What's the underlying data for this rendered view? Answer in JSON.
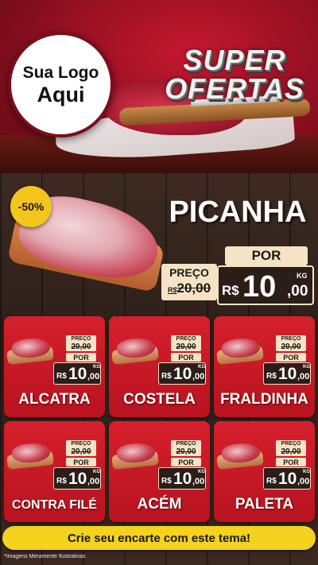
{
  "header": {
    "logo_line1": "Sua Logo",
    "logo_line2": "Aqui",
    "title_line1": "SUPER",
    "title_line2": "OFERTAS"
  },
  "featured": {
    "discount": "-50%",
    "name": "PICANHA",
    "por_label": "POR",
    "preco_label": "PREÇO",
    "old_currency": "R$",
    "old_price": "20,00",
    "new_currency": "R$",
    "new_int": "10",
    "new_dec": ",00",
    "unit": "KG"
  },
  "cards": [
    {
      "name": "ALCATRA",
      "preco_label": "PREÇO",
      "old_price": "20,00",
      "por_label": "POR",
      "currency": "R$",
      "new_int": "10",
      "new_dec": ",00",
      "unit": "KG"
    },
    {
      "name": "COSTELA",
      "preco_label": "PREÇO",
      "old_price": "20,00",
      "por_label": "POR",
      "currency": "R$",
      "new_int": "10",
      "new_dec": ",00",
      "unit": "KG"
    },
    {
      "name": "FRALDINHA",
      "preco_label": "PREÇO",
      "old_price": "20,00",
      "por_label": "POR",
      "currency": "R$",
      "new_int": "10",
      "new_dec": ",00",
      "unit": "KG"
    },
    {
      "name": "CONTRA FILÉ",
      "preco_label": "PREÇO",
      "old_price": "20,00",
      "por_label": "POR",
      "currency": "R$",
      "new_int": "10",
      "new_dec": ",00",
      "unit": "KG"
    },
    {
      "name": "ACÉM",
      "preco_label": "PREÇO",
      "old_price": "20,00",
      "por_label": "POR",
      "currency": "R$",
      "new_int": "10",
      "new_dec": ",00",
      "unit": "KG"
    },
    {
      "name": "PALETA",
      "preco_label": "PREÇO",
      "old_price": "20,00",
      "por_label": "POR",
      "currency": "R$",
      "new_int": "10",
      "new_dec": ",00",
      "unit": "KG"
    }
  ],
  "cta": {
    "label": "Crie seu encarte com este tema!"
  },
  "disclaimer": "*Imagens Meramente Ilustrativas",
  "colors": {
    "accent_red": "#d61f2c",
    "accent_yellow": "#f4d21e",
    "cream": "#f5e3c4",
    "dark": "#2b1d18"
  }
}
